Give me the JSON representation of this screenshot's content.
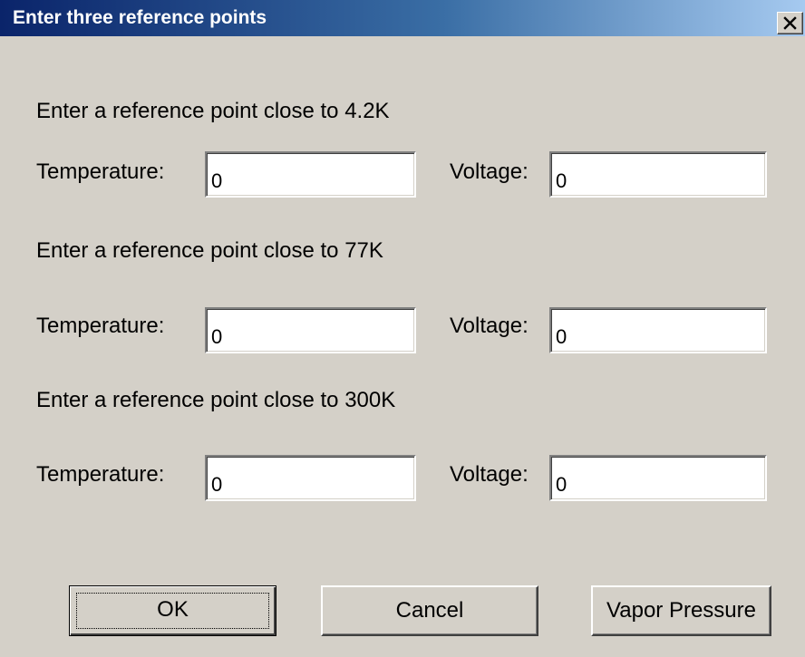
{
  "window": {
    "title": "Enter three reference points",
    "close_glyph": "✕"
  },
  "sections": [
    {
      "heading": "Enter a reference point close to 4.2K",
      "temperature_label": "Temperature:",
      "temperature_value": "0",
      "voltage_label": "Voltage:",
      "voltage_value": "0"
    },
    {
      "heading": "Enter a reference point close to 77K",
      "temperature_label": "Temperature:",
      "temperature_value": "0",
      "voltage_label": "Voltage:",
      "voltage_value": "0"
    },
    {
      "heading": "Enter a reference point close to 300K",
      "temperature_label": "Temperature:",
      "temperature_value": "0",
      "voltage_label": "Voltage:",
      "voltage_value": "0"
    }
  ],
  "buttons": {
    "ok": "OK",
    "cancel": "Cancel",
    "vapor_pressure": "Vapor Pressure"
  },
  "colors": {
    "dialog_background": "#d4d0c8",
    "titlebar_start": "#0a246a",
    "titlebar_end": "#a6caf0",
    "title_text": "#ffffff"
  }
}
